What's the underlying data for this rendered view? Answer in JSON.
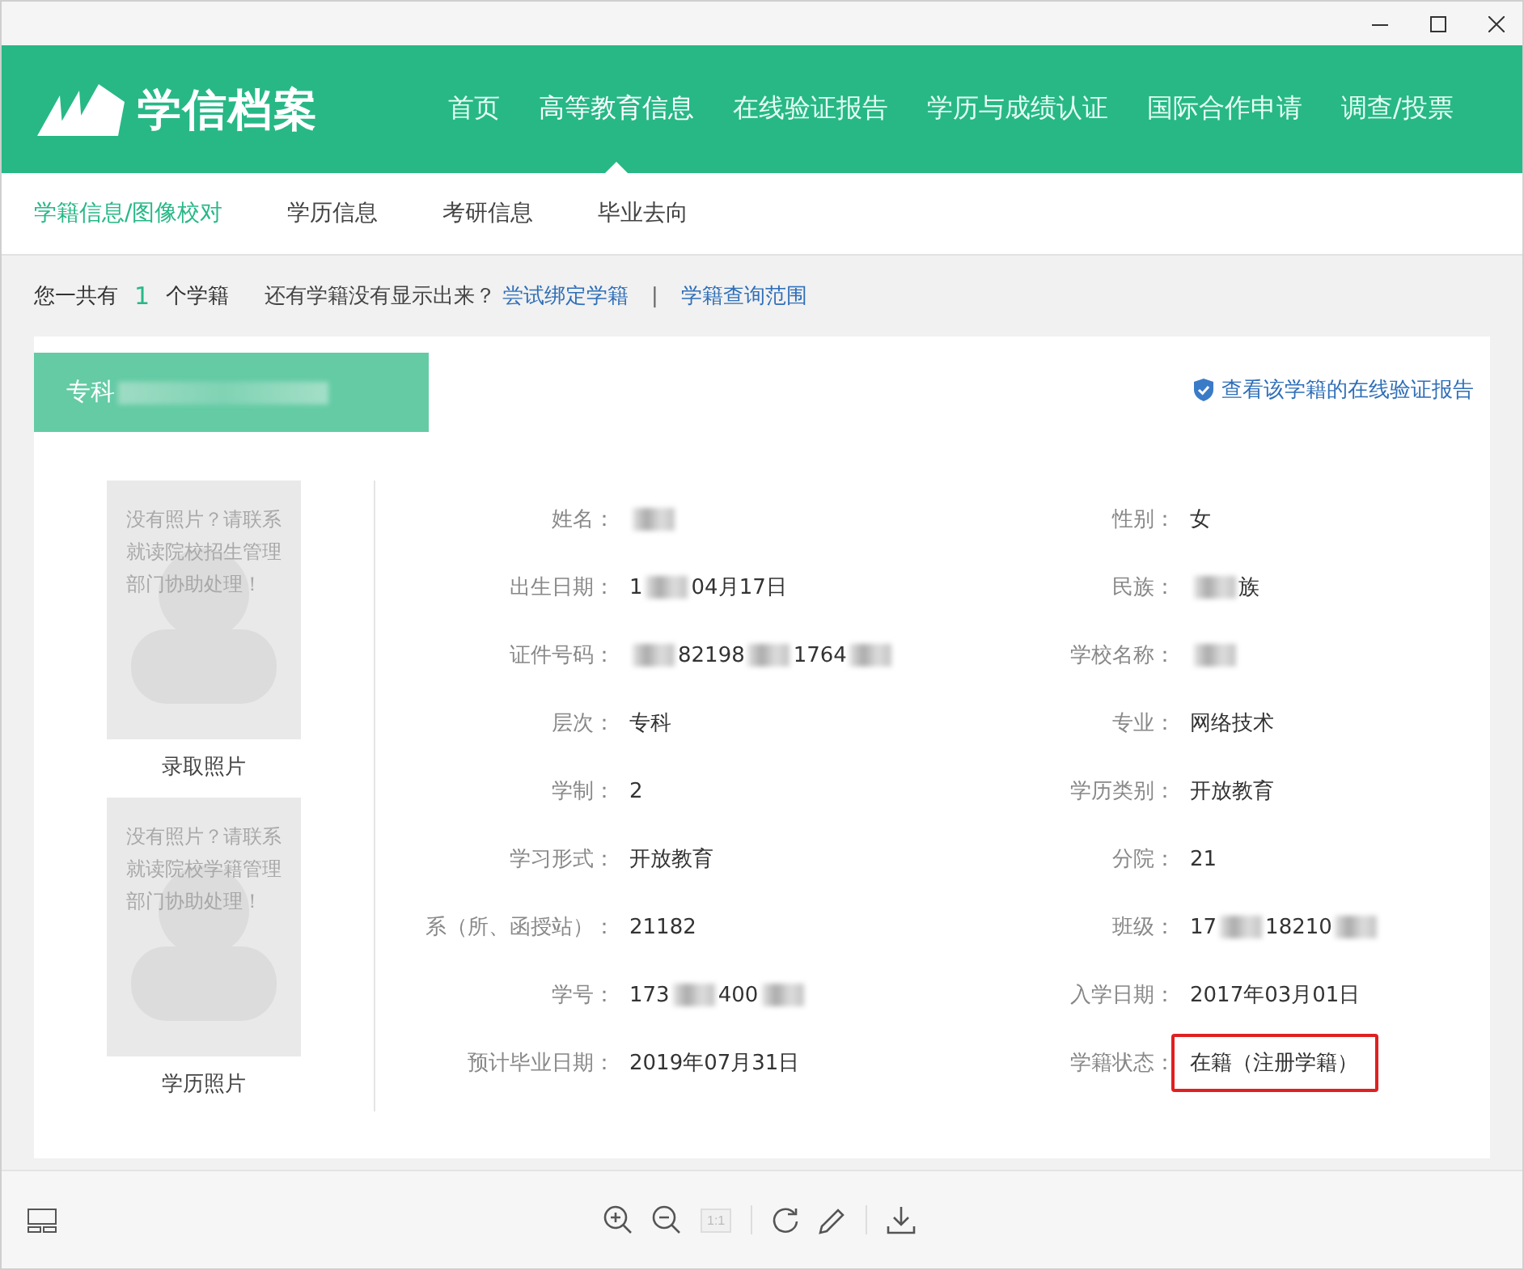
{
  "header": {
    "logo_text": "学信档案",
    "nav": [
      {
        "label": "首页",
        "selected": false
      },
      {
        "label": "高等教育信息",
        "selected": true
      },
      {
        "label": "在线验证报告",
        "selected": false
      },
      {
        "label": "学历与成绩认证",
        "selected": false
      },
      {
        "label": "国际合作申请",
        "selected": false
      },
      {
        "label": "调查/投票",
        "selected": false
      }
    ]
  },
  "subnav": [
    {
      "label": "学籍信息/图像校对",
      "selected": true
    },
    {
      "label": "学历信息",
      "selected": false
    },
    {
      "label": "考研信息",
      "selected": false
    },
    {
      "label": "毕业去向",
      "selected": false
    }
  ],
  "summary": {
    "prefix": "您一共有",
    "count": "1",
    "suffix": "个学籍",
    "question": "还有学籍没有显示出来？",
    "links": [
      "尝试绑定学籍",
      "学籍查询范围"
    ],
    "separator": "|"
  },
  "card": {
    "tab": [
      {
        "kind": "text",
        "text": "专科"
      },
      {
        "kind": "blur"
      }
    ],
    "report_link": "查看该学籍的在线验证报告",
    "photos": [
      {
        "message": "没有照片？请联系就读院校招生管理部门协助处理！",
        "caption": "录取照片"
      },
      {
        "message": "没有照片？请联系就读院校学籍管理部门协助处理！",
        "caption": "学历照片"
      }
    ],
    "fields": [
      {
        "label": "姓名：",
        "value": [
          {
            "kind": "blur"
          }
        ],
        "highlighted": false
      },
      {
        "label": "性别：",
        "value": [
          {
            "kind": "text",
            "text": "女"
          }
        ],
        "highlighted": false
      },
      {
        "label": "出生日期：",
        "value": [
          {
            "kind": "text",
            "text": "1"
          },
          {
            "kind": "blur"
          },
          {
            "kind": "text",
            "text": "04月17日"
          }
        ],
        "highlighted": false
      },
      {
        "label": "民族：",
        "value": [
          {
            "kind": "blur"
          },
          {
            "kind": "text",
            "text": "族"
          }
        ],
        "highlighted": false
      },
      {
        "label": "证件号码：",
        "value": [
          {
            "kind": "blur"
          },
          {
            "kind": "text",
            "text": "82198"
          },
          {
            "kind": "blur"
          },
          {
            "kind": "text",
            "text": "1764"
          },
          {
            "kind": "blur"
          }
        ],
        "highlighted": false
      },
      {
        "label": "学校名称：",
        "value": [
          {
            "kind": "blur"
          }
        ],
        "highlighted": false
      },
      {
        "label": "层次：",
        "value": [
          {
            "kind": "text",
            "text": "专科"
          }
        ],
        "highlighted": false
      },
      {
        "label": "专业：",
        "value": [
          {
            "kind": "text",
            "text": "网络技术"
          }
        ],
        "highlighted": false
      },
      {
        "label": "学制：",
        "value": [
          {
            "kind": "text",
            "text": "2"
          }
        ],
        "highlighted": false
      },
      {
        "label": "学历类别：",
        "value": [
          {
            "kind": "text",
            "text": "开放教育"
          }
        ],
        "highlighted": false
      },
      {
        "label": "学习形式：",
        "value": [
          {
            "kind": "text",
            "text": "开放教育"
          }
        ],
        "highlighted": false
      },
      {
        "label": "分院：",
        "value": [
          {
            "kind": "text",
            "text": "21"
          }
        ],
        "highlighted": false
      },
      {
        "label": "系（所、函授站）：",
        "value": [
          {
            "kind": "text",
            "text": "21182"
          }
        ],
        "highlighted": false
      },
      {
        "label": "班级：",
        "value": [
          {
            "kind": "text",
            "text": "17"
          },
          {
            "kind": "blur"
          },
          {
            "kind": "text",
            "text": "18210"
          },
          {
            "kind": "blur"
          }
        ],
        "highlighted": false
      },
      {
        "label": "学号：",
        "value": [
          {
            "kind": "text",
            "text": "173"
          },
          {
            "kind": "blur"
          },
          {
            "kind": "text",
            "text": "400"
          },
          {
            "kind": "blur"
          }
        ],
        "highlighted": false
      },
      {
        "label": "入学日期：",
        "value": [
          {
            "kind": "text",
            "text": "2017年03月01日"
          }
        ],
        "highlighted": false
      },
      {
        "label": "预计毕业日期：",
        "value": [
          {
            "kind": "text",
            "text": "2019年07月31日"
          }
        ],
        "highlighted": false
      },
      {
        "label": "学籍状态：",
        "value": [
          {
            "kind": "text",
            "text": "在籍（注册学籍）"
          }
        ],
        "highlighted": true
      }
    ]
  },
  "toolbar": {
    "actual_size": {
      "label": "1:1",
      "disabled": true
    }
  }
}
